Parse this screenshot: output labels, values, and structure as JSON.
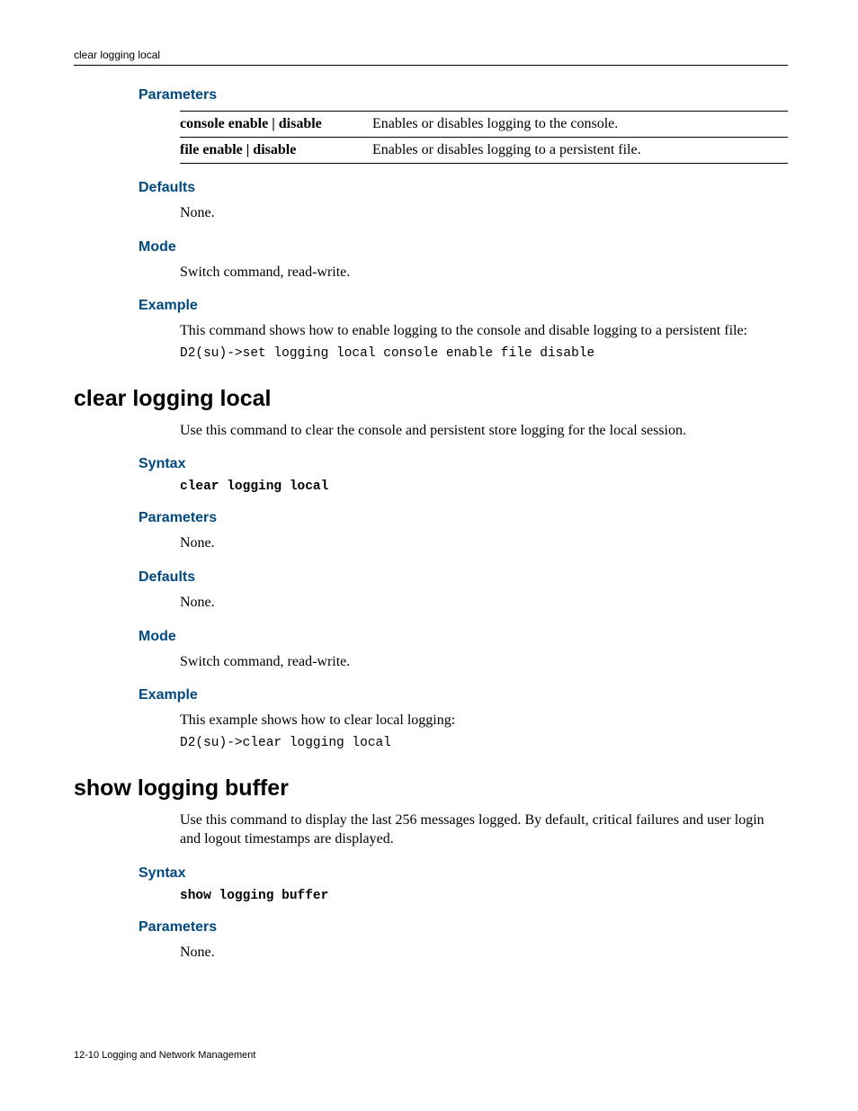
{
  "running_head": "clear logging local",
  "section1": {
    "params_title": "Parameters",
    "param_rows": [
      {
        "key": "console enable | disable",
        "desc": "Enables or disables logging to the console."
      },
      {
        "key": "file enable | disable",
        "desc": "Enables or disables logging to a persistent file."
      }
    ],
    "defaults_title": "Defaults",
    "defaults_text": "None.",
    "mode_title": "Mode",
    "mode_text": "Switch command, read-write.",
    "example_title": "Example",
    "example_text": "This command shows how to enable logging to the console and disable logging to a persistent file:",
    "example_cmd": "D2(su)->set logging local console enable file disable"
  },
  "section2": {
    "title": "clear logging local",
    "intro": "Use this command to clear the console and persistent store logging for the local session.",
    "syntax_title": "Syntax",
    "syntax_cmd": "clear logging local",
    "params_title": "Parameters",
    "params_text": "None.",
    "defaults_title": "Defaults",
    "defaults_text": "None.",
    "mode_title": "Mode",
    "mode_text": "Switch command, read-write.",
    "example_title": "Example",
    "example_text": "This example shows how to clear local logging:",
    "example_cmd": "D2(su)->clear logging local"
  },
  "section3": {
    "title": "show logging buffer",
    "intro": "Use this command to display the last 256 messages logged. By default, critical failures and user login and logout timestamps are displayed.",
    "syntax_title": "Syntax",
    "syntax_cmd": "show logging buffer",
    "params_title": "Parameters",
    "params_text": "None."
  },
  "footer": "12-10   Logging and Network Management"
}
